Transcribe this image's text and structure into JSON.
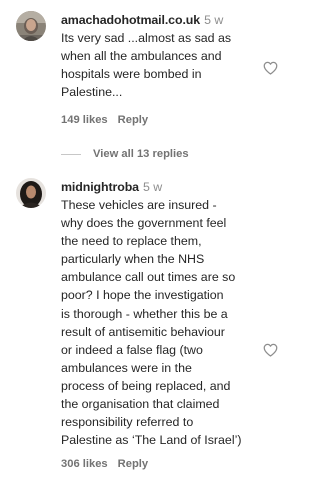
{
  "comments": [
    {
      "username": "amachadohotmail.co.uk",
      "time": "5 w",
      "lines": [
        "Its very sad ...almost as sad as",
        "when all the ambulances and",
        "hospitals were bombed in",
        "Palestine..."
      ],
      "likes": "149 likes",
      "reply": "Reply",
      "avatar_icon": "profile-photo",
      "like_icon": "heart-outline-icon"
    },
    {
      "username": "midnightroba",
      "time": "5 w",
      "lines": [
        "These vehicles are insured -",
        "why does the government feel",
        "the need to replace them,",
        "particularly when the NHS",
        "ambulance call out times are so",
        "poor? I hope the investigation",
        "is thorough - whether this be a",
        "result of antisemitic behaviour",
        "or indeed a false flag (two",
        "ambulances were in the",
        "process of being replaced, and",
        "the organisation that claimed",
        "responsibility referred to",
        "Palestine as ‘The Land of Israel’)"
      ],
      "likes": "306 likes",
      "reply": "Reply",
      "avatar_icon": "profile-photo",
      "like_icon": "heart-outline-icon"
    }
  ],
  "view_replies": "View all 13 replies",
  "colors": {
    "text": "#262626",
    "muted": "#737373",
    "timestamp": "#8e8e8e",
    "divider": "#c7c7c7"
  }
}
